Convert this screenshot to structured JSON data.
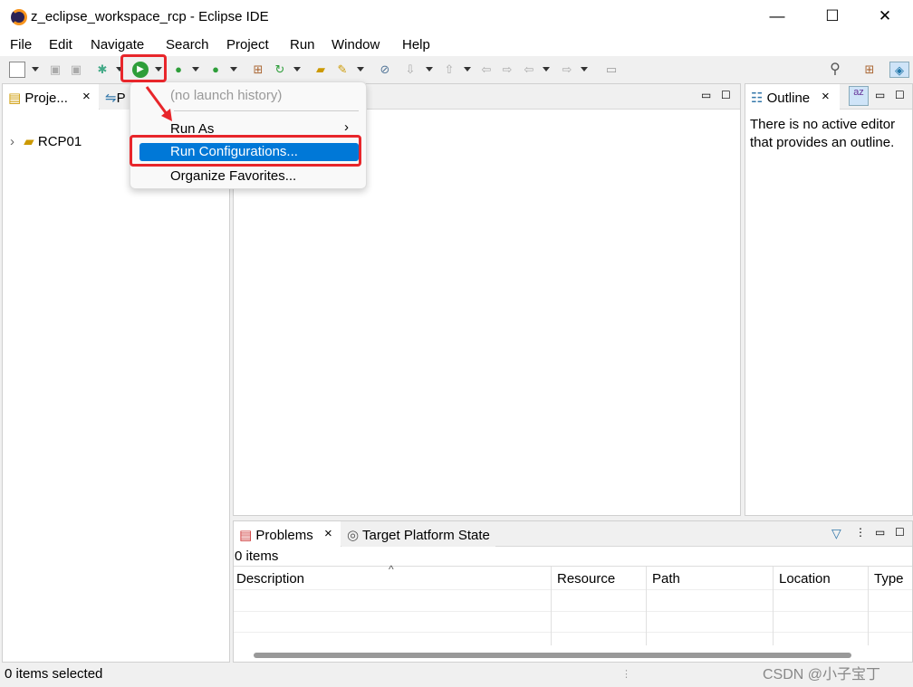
{
  "window": {
    "title": "z_eclipse_workspace_rcp - Eclipse IDE",
    "minimize": "—",
    "maximize": "☐",
    "close": "✕"
  },
  "menubar": [
    "File",
    "Edit",
    "Navigate",
    "Search",
    "Project",
    "Run",
    "Window",
    "Help"
  ],
  "run_menu": {
    "no_history": "(no launch history)",
    "run_as": "Run As",
    "run_as_arrow": "›",
    "run_configurations": "Run Configurations...",
    "organize_favorites": "Organize Favorites..."
  },
  "project_explorer": {
    "tab": "Proje...",
    "tab2": "P",
    "close": "×",
    "items": [
      {
        "label": "RCP01",
        "expander": "›"
      }
    ]
  },
  "outline": {
    "tab": "Outline",
    "close": "×",
    "message": "There is no active editor that provides an outline."
  },
  "problems": {
    "tab": "Problems",
    "close": "×",
    "tab2": "Target Platform State",
    "count": "0 items",
    "columns": [
      "Description",
      "Resource",
      "Path",
      "Location",
      "Type"
    ],
    "sort_indicator": "^"
  },
  "status": {
    "text": "0 items selected"
  },
  "watermark": "CSDN @小子宝丁",
  "colors": {
    "selection": "#0078d7",
    "highlight_box": "#e8262b",
    "run_green": "#2e9e3a"
  }
}
